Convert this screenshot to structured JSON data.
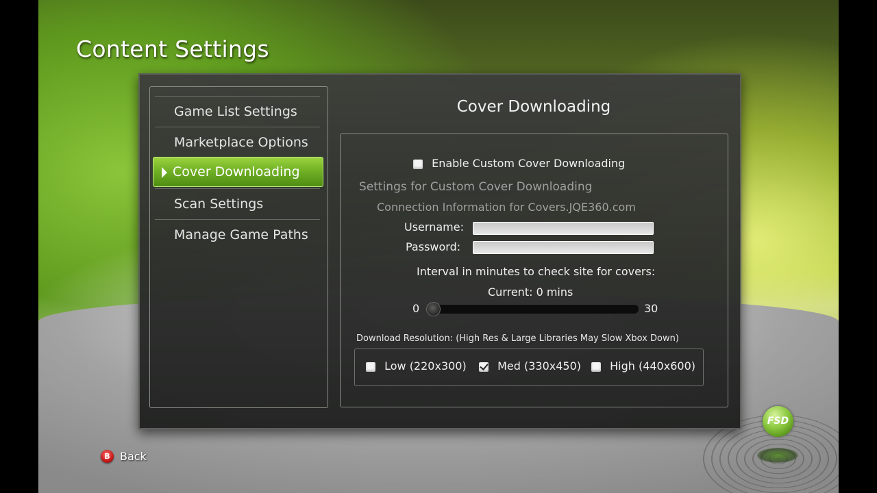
{
  "page": {
    "title": "Content Settings"
  },
  "sidebar": {
    "items": [
      {
        "label": "Game List Settings"
      },
      {
        "label": "Marketplace Options"
      },
      {
        "label": "Cover Downloading"
      },
      {
        "label": "Scan Settings"
      },
      {
        "label": "Manage Game Paths"
      }
    ],
    "selected_index": 2
  },
  "content": {
    "title": "Cover Downloading",
    "enable_custom": {
      "label": "Enable Custom Cover Downloading",
      "checked": false
    },
    "settings_heading": "Settings for Custom Cover Downloading",
    "connection_heading": "Connection Information for Covers.JQE360.com",
    "username": {
      "label": "Username:",
      "value": ""
    },
    "password": {
      "label": "Password:",
      "value": ""
    },
    "interval": {
      "label": "Interval in minutes to check site for covers:",
      "current_text": "Current: 0 mins",
      "min_label": "0",
      "max_label": "30",
      "value": 0,
      "min": 0,
      "max": 30
    },
    "resolution": {
      "label": "Download Resolution:  (High Res & Large Libraries May Slow Xbox Down)",
      "options": [
        {
          "label": "Low (220x300)",
          "checked": false
        },
        {
          "label": "Med (330x450)",
          "checked": true
        },
        {
          "label": "High (440x600)",
          "checked": false
        }
      ]
    }
  },
  "footer": {
    "back_button_glyph": "B",
    "back_label": "Back",
    "back_button_color": "#c41a1a"
  },
  "brand": {
    "logo_text": "FSD",
    "accent_color": "#6fae24"
  }
}
